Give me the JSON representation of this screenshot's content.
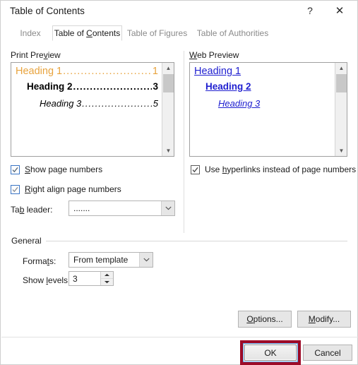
{
  "window": {
    "title": "Table of Contents",
    "help_button": "?",
    "close_button": "✕"
  },
  "tabs": [
    {
      "label": "Index",
      "active": false
    },
    {
      "label": "Table of Contents",
      "active": true,
      "accel": "C"
    },
    {
      "label": "Table of Figures",
      "active": false
    },
    {
      "label": "Table of Authorities",
      "active": false
    }
  ],
  "print_preview": {
    "group_label": "Print Preview",
    "group_label_accel": "v",
    "entries": [
      {
        "title": "Heading 1",
        "leader": "..................................",
        "page": "1",
        "style": "h1"
      },
      {
        "title": "Heading 2",
        "leader": "........................",
        "page": "3",
        "style": "h2"
      },
      {
        "title": "Heading 3",
        "leader": "......................",
        "page": "5",
        "style": "h3"
      }
    ],
    "scrollbar": {
      "up_arrow": "▲",
      "down_arrow": "▼"
    }
  },
  "web_preview": {
    "group_label": "Web Preview",
    "group_label_accel": "W",
    "entries": [
      {
        "title": "Heading 1",
        "style": "h1"
      },
      {
        "title": "Heading 2",
        "style": "h2"
      },
      {
        "title": "Heading 3",
        "style": "h3"
      }
    ],
    "scrollbar": {
      "up_arrow": "▲",
      "down_arrow": "▼"
    }
  },
  "options": {
    "show_page_numbers": {
      "label_pre": "",
      "label_accel": "S",
      "label_post": "how page numbers",
      "checked": true
    },
    "right_align_page_numbers": {
      "label_pre": "",
      "label_accel": "R",
      "label_post": "ight align page numbers",
      "checked": true
    },
    "use_hyperlinks": {
      "label_pre": "Use ",
      "label_accel": "h",
      "label_post": "yperlinks instead of page numbers",
      "checked": true
    },
    "tab_leader": {
      "label_pre": "Ta",
      "label_accel": "b",
      "label_post": " leader:",
      "value": "......."
    }
  },
  "general": {
    "group_label": "General",
    "formats": {
      "label_pre": "Forma",
      "label_accel": "t",
      "label_post": "s:",
      "value": "From template"
    },
    "show_levels": {
      "label_pre": "Show ",
      "label_accel": "l",
      "label_post": "evels:",
      "value": "3",
      "up_arrow": "▲",
      "down_arrow": "▼"
    }
  },
  "buttons": {
    "options": {
      "label_pre": "",
      "label_accel": "O",
      "label_post": "ptions..."
    },
    "modify": {
      "label_pre": "",
      "label_accel": "M",
      "label_post": "odify..."
    },
    "ok": {
      "label": "OK"
    },
    "cancel": {
      "label": "Cancel"
    }
  },
  "colors": {
    "heading1_print": "#e8a33d",
    "heading_link": "#2020d0",
    "checkbox_border": "#3a74c4",
    "annotation": "#9e0b28",
    "focus_ring": "#5aa0e0"
  },
  "glyphs": {
    "chevron_down": "⌄",
    "caret_up": "▲",
    "caret_down": "▼"
  }
}
